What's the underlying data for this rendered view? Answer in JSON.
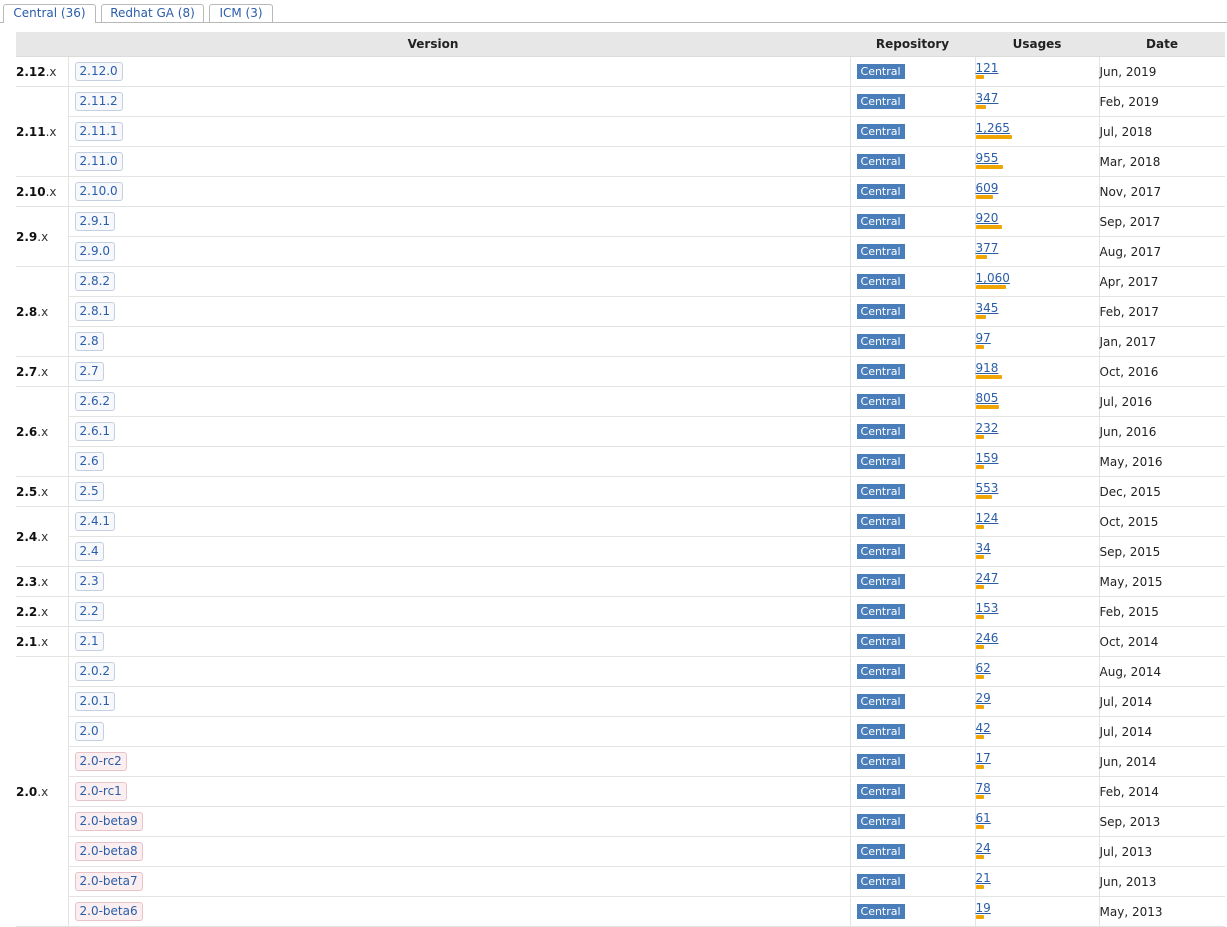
{
  "tabs": [
    {
      "label": "Central (36)",
      "active": true
    },
    {
      "label": "Redhat GA (8)",
      "active": false
    },
    {
      "label": "ICM (3)",
      "active": false
    }
  ],
  "table": {
    "headers": {
      "version": "Version",
      "repository": "Repository",
      "usages": "Usages",
      "date": "Date"
    },
    "max_usage": 1265,
    "groups": [
      {
        "major": "2.12",
        "suffix": ".x",
        "rows": [
          {
            "version": "2.12.0",
            "repo": "Central",
            "usages": "121",
            "usage_value": 121,
            "date": "Jun, 2019",
            "pre": false
          }
        ]
      },
      {
        "major": "2.11",
        "suffix": ".x",
        "rows": [
          {
            "version": "2.11.2",
            "repo": "Central",
            "usages": "347",
            "usage_value": 347,
            "date": "Feb, 2019",
            "pre": false
          },
          {
            "version": "2.11.1",
            "repo": "Central",
            "usages": "1,265",
            "usage_value": 1265,
            "date": "Jul, 2018",
            "pre": false
          },
          {
            "version": "2.11.0",
            "repo": "Central",
            "usages": "955",
            "usage_value": 955,
            "date": "Mar, 2018",
            "pre": false
          }
        ]
      },
      {
        "major": "2.10",
        "suffix": ".x",
        "rows": [
          {
            "version": "2.10.0",
            "repo": "Central",
            "usages": "609",
            "usage_value": 609,
            "date": "Nov, 2017",
            "pre": false
          }
        ]
      },
      {
        "major": "2.9",
        "suffix": ".x",
        "rows": [
          {
            "version": "2.9.1",
            "repo": "Central",
            "usages": "920",
            "usage_value": 920,
            "date": "Sep, 2017",
            "pre": false
          },
          {
            "version": "2.9.0",
            "repo": "Central",
            "usages": "377",
            "usage_value": 377,
            "date": "Aug, 2017",
            "pre": false
          }
        ]
      },
      {
        "major": "2.8",
        "suffix": ".x",
        "rows": [
          {
            "version": "2.8.2",
            "repo": "Central",
            "usages": "1,060",
            "usage_value": 1060,
            "date": "Apr, 2017",
            "pre": false
          },
          {
            "version": "2.8.1",
            "repo": "Central",
            "usages": "345",
            "usage_value": 345,
            "date": "Feb, 2017",
            "pre": false
          },
          {
            "version": "2.8",
            "repo": "Central",
            "usages": "97",
            "usage_value": 97,
            "date": "Jan, 2017",
            "pre": false
          }
        ]
      },
      {
        "major": "2.7",
        "suffix": ".x",
        "rows": [
          {
            "version": "2.7",
            "repo": "Central",
            "usages": "918",
            "usage_value": 918,
            "date": "Oct, 2016",
            "pre": false
          }
        ]
      },
      {
        "major": "2.6",
        "suffix": ".x",
        "rows": [
          {
            "version": "2.6.2",
            "repo": "Central",
            "usages": "805",
            "usage_value": 805,
            "date": "Jul, 2016",
            "pre": false
          },
          {
            "version": "2.6.1",
            "repo": "Central",
            "usages": "232",
            "usage_value": 232,
            "date": "Jun, 2016",
            "pre": false
          },
          {
            "version": "2.6",
            "repo": "Central",
            "usages": "159",
            "usage_value": 159,
            "date": "May, 2016",
            "pre": false
          }
        ]
      },
      {
        "major": "2.5",
        "suffix": ".x",
        "rows": [
          {
            "version": "2.5",
            "repo": "Central",
            "usages": "553",
            "usage_value": 553,
            "date": "Dec, 2015",
            "pre": false
          }
        ]
      },
      {
        "major": "2.4",
        "suffix": ".x",
        "rows": [
          {
            "version": "2.4.1",
            "repo": "Central",
            "usages": "124",
            "usage_value": 124,
            "date": "Oct, 2015",
            "pre": false
          },
          {
            "version": "2.4",
            "repo": "Central",
            "usages": "34",
            "usage_value": 34,
            "date": "Sep, 2015",
            "pre": false
          }
        ]
      },
      {
        "major": "2.3",
        "suffix": ".x",
        "rows": [
          {
            "version": "2.3",
            "repo": "Central",
            "usages": "247",
            "usage_value": 247,
            "date": "May, 2015",
            "pre": false
          }
        ]
      },
      {
        "major": "2.2",
        "suffix": ".x",
        "rows": [
          {
            "version": "2.2",
            "repo": "Central",
            "usages": "153",
            "usage_value": 153,
            "date": "Feb, 2015",
            "pre": false
          }
        ]
      },
      {
        "major": "2.1",
        "suffix": ".x",
        "rows": [
          {
            "version": "2.1",
            "repo": "Central",
            "usages": "246",
            "usage_value": 246,
            "date": "Oct, 2014",
            "pre": false
          }
        ]
      },
      {
        "major": "2.0",
        "suffix": ".x",
        "rows": [
          {
            "version": "2.0.2",
            "repo": "Central",
            "usages": "62",
            "usage_value": 62,
            "date": "Aug, 2014",
            "pre": false
          },
          {
            "version": "2.0.1",
            "repo": "Central",
            "usages": "29",
            "usage_value": 29,
            "date": "Jul, 2014",
            "pre": false
          },
          {
            "version": "2.0",
            "repo": "Central",
            "usages": "42",
            "usage_value": 42,
            "date": "Jul, 2014",
            "pre": false
          },
          {
            "version": "2.0-rc2",
            "repo": "Central",
            "usages": "17",
            "usage_value": 17,
            "date": "Jun, 2014",
            "pre": true
          },
          {
            "version": "2.0-rc1",
            "repo": "Central",
            "usages": "78",
            "usage_value": 78,
            "date": "Feb, 2014",
            "pre": true
          },
          {
            "version": "2.0-beta9",
            "repo": "Central",
            "usages": "61",
            "usage_value": 61,
            "date": "Sep, 2013",
            "pre": true
          },
          {
            "version": "2.0-beta8",
            "repo": "Central",
            "usages": "24",
            "usage_value": 24,
            "date": "Jul, 2013",
            "pre": true
          },
          {
            "version": "2.0-beta7",
            "repo": "Central",
            "usages": "21",
            "usage_value": 21,
            "date": "Jun, 2013",
            "pre": true
          },
          {
            "version": "2.0-beta6",
            "repo": "Central",
            "usages": "19",
            "usage_value": 19,
            "date": "May, 2013",
            "pre": true
          }
        ]
      }
    ]
  },
  "colors": {
    "link": "#2a5da8",
    "repo_badge": "#4a7ebb",
    "usage_bar": "#f0a500",
    "header_bg": "#e7e7e7"
  }
}
